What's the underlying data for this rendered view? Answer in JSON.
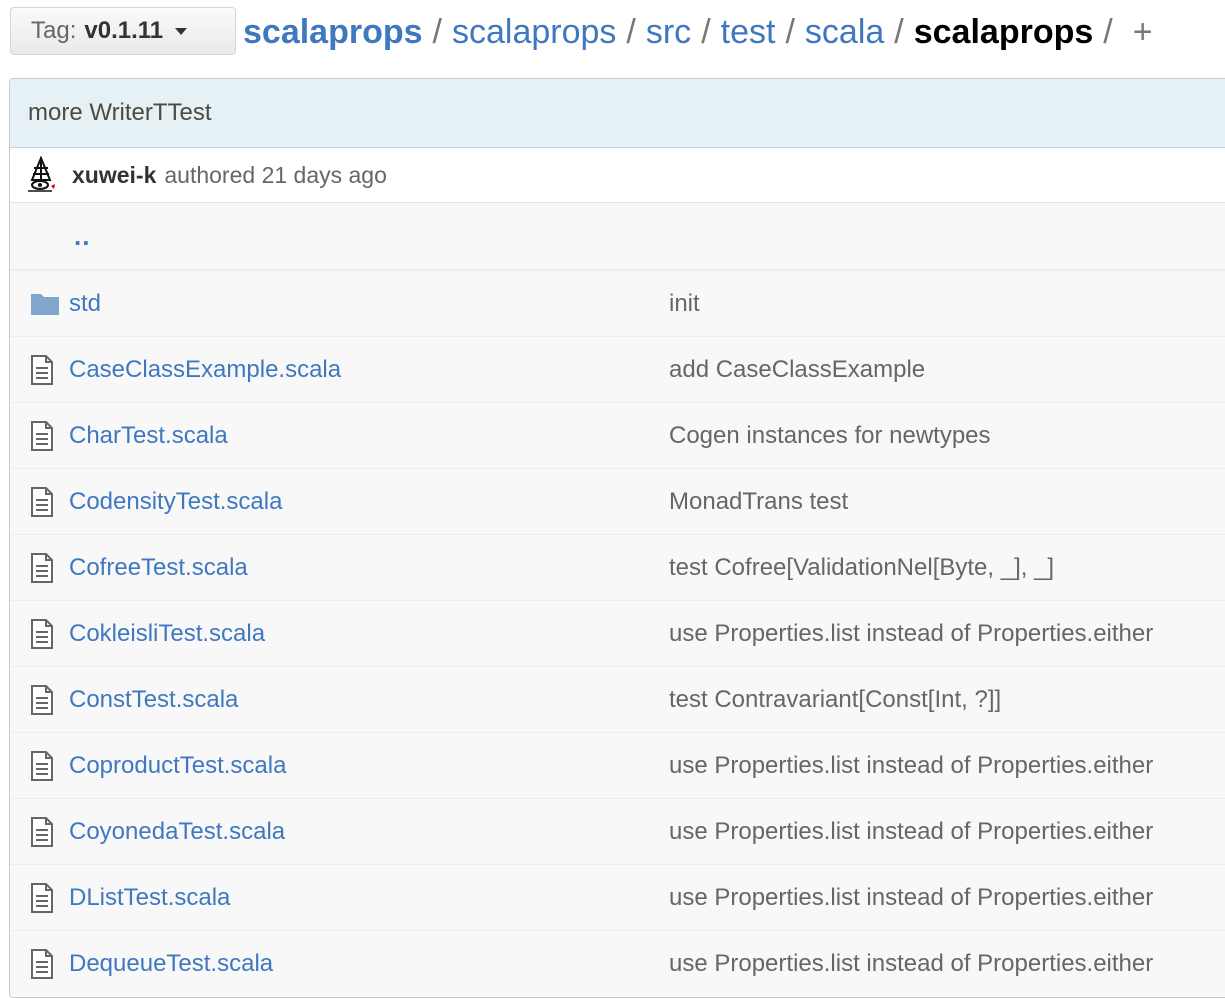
{
  "tag": {
    "prefix": "Tag:",
    "value": "v0.1.11"
  },
  "breadcrumb": {
    "repo": "scalaprops",
    "parts": [
      "scalaprops",
      "src",
      "test",
      "scala"
    ],
    "current": "scalaprops",
    "separator": "/",
    "plus": "+"
  },
  "commit": {
    "message": "more WriterTTest",
    "author": "xuwei-k",
    "authored": "authored 21 days ago"
  },
  "up_link": "..",
  "files": [
    {
      "type": "folder",
      "name": "std",
      "message": "init"
    },
    {
      "type": "file",
      "name": "CaseClassExample.scala",
      "message": "add CaseClassExample"
    },
    {
      "type": "file",
      "name": "CharTest.scala",
      "message": "Cogen instances for newtypes"
    },
    {
      "type": "file",
      "name": "CodensityTest.scala",
      "message": "MonadTrans test"
    },
    {
      "type": "file",
      "name": "CofreeTest.scala",
      "message": "test Cofree[ValidationNel[Byte, _], _]"
    },
    {
      "type": "file",
      "name": "CokleisliTest.scala",
      "message": "use Properties.list instead of Properties.either"
    },
    {
      "type": "file",
      "name": "ConstTest.scala",
      "message": "test Contravariant[Const[Int, ?]]"
    },
    {
      "type": "file",
      "name": "CoproductTest.scala",
      "message": "use Properties.list instead of Properties.either"
    },
    {
      "type": "file",
      "name": "CoyonedaTest.scala",
      "message": "use Properties.list instead of Properties.either"
    },
    {
      "type": "file",
      "name": "DListTest.scala",
      "message": "use Properties.list instead of Properties.either"
    },
    {
      "type": "file",
      "name": "DequeueTest.scala",
      "message": "use Properties.list instead of Properties.either"
    }
  ],
  "colors": {
    "link": "#4078c0",
    "commit_bg": "#e6f1f6",
    "row_bg": "#f8f8f8",
    "folder_icon": "#80a6cd"
  }
}
